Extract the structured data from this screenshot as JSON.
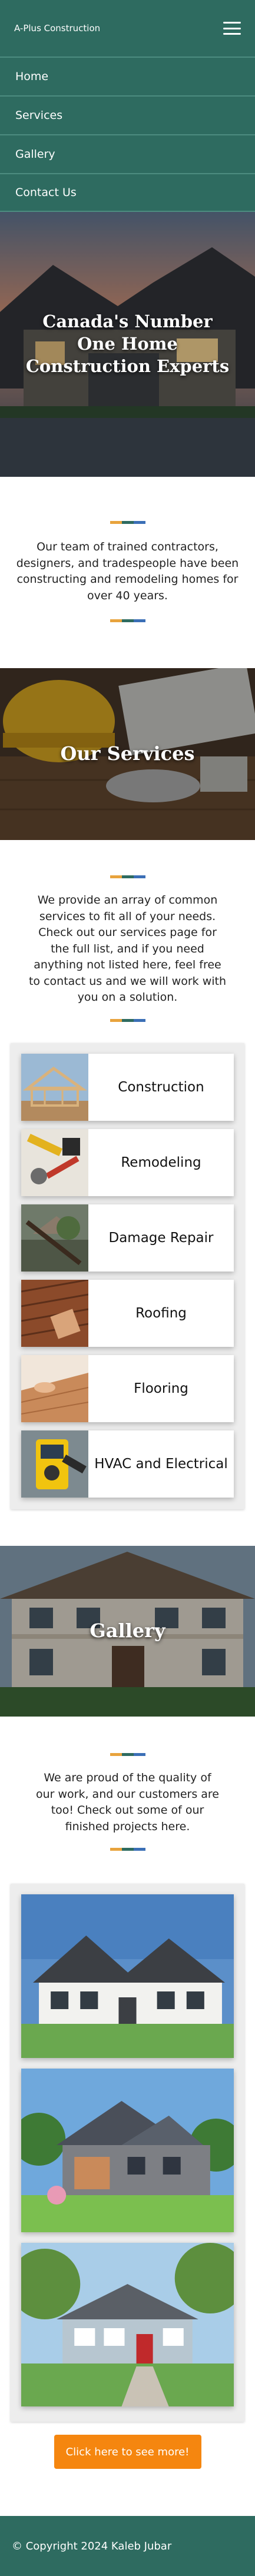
{
  "header": {
    "brand": "A-Plus Construction",
    "menu_icon": "hamburger-menu-icon"
  },
  "nav": {
    "items": [
      {
        "label": "Home"
      },
      {
        "label": "Services"
      },
      {
        "label": "Gallery"
      },
      {
        "label": "Contact Us"
      }
    ]
  },
  "hero": {
    "title": "Canada's Number One Home Construction Experts"
  },
  "intro": {
    "text": "Our team of trained contractors, designers, and tradespeople have been constructing and remodeling homes for over 40 years."
  },
  "divider_colors": [
    "#e8a33d",
    "#2e6b60",
    "#3b6fb6"
  ],
  "services": {
    "banner_title": "Our Services",
    "text": "We provide an array of common services to fit all of your needs. Check out our services page for the full list, and if you need anything not listed here, feel free to contact us and we will work with you on a solution.",
    "cards": [
      {
        "label": "Construction",
        "icon": "house-frame-image"
      },
      {
        "label": "Remodeling",
        "icon": "tools-image"
      },
      {
        "label": "Damage Repair",
        "icon": "storm-damage-image"
      },
      {
        "label": "Roofing",
        "icon": "roof-shingles-image"
      },
      {
        "label": "Flooring",
        "icon": "wood-floor-image"
      },
      {
        "label": "HVAC and Electrical",
        "icon": "multimeter-image"
      }
    ]
  },
  "gallery": {
    "banner_title": "Gallery",
    "text": "We are proud of the quality of our work, and our customers are too! Check out some of our finished projects here.",
    "cta_label": "Click here to see more!"
  },
  "footer": {
    "text": "© Copyright 2024 Kaleb Jubar"
  },
  "colors": {
    "primary": "#2e6b60",
    "accent": "#f5860f"
  }
}
